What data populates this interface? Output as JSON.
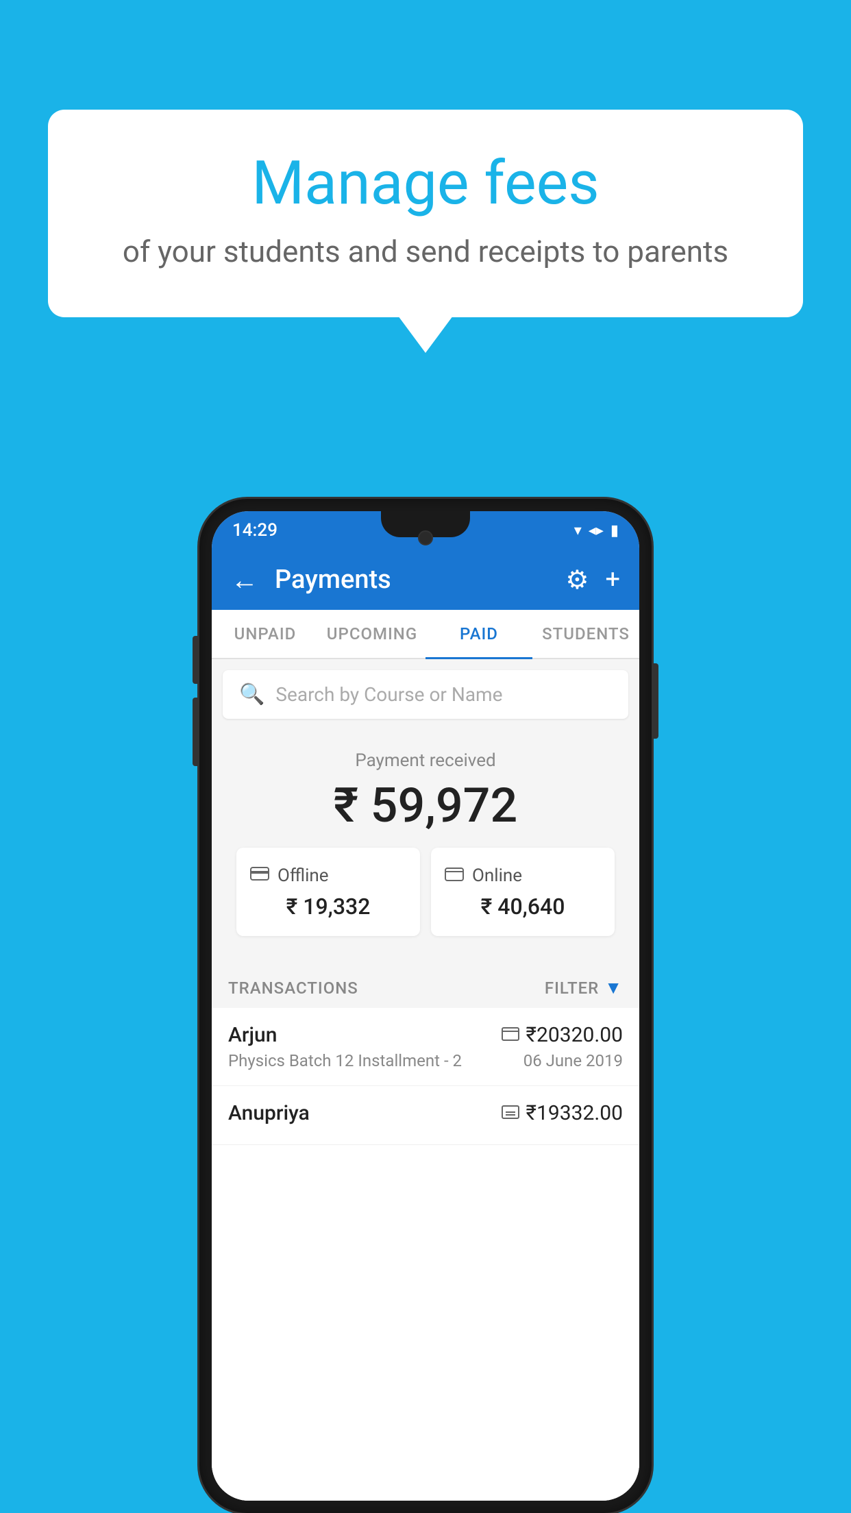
{
  "background_color": "#1ab3e8",
  "speech_bubble": {
    "title": "Manage fees",
    "subtitle": "of your students and send receipts to parents"
  },
  "status_bar": {
    "time": "14:29",
    "wifi": "▾",
    "signal": "▲",
    "battery": "▮"
  },
  "app_bar": {
    "title": "Payments",
    "back_icon": "←",
    "gear_icon": "⚙",
    "plus_icon": "+"
  },
  "tabs": [
    {
      "label": "UNPAID",
      "active": false
    },
    {
      "label": "UPCOMING",
      "active": false
    },
    {
      "label": "PAID",
      "active": true
    },
    {
      "label": "STUDENTS",
      "active": false
    }
  ],
  "search": {
    "placeholder": "Search by Course or Name"
  },
  "payment_summary": {
    "label": "Payment received",
    "amount": "₹ 59,972"
  },
  "payment_cards": [
    {
      "icon": "💳",
      "label": "Offline",
      "amount": "₹ 19,332"
    },
    {
      "icon": "💳",
      "label": "Online",
      "amount": "₹ 40,640"
    }
  ],
  "transactions_header": {
    "label": "TRANSACTIONS",
    "filter_label": "FILTER"
  },
  "transactions": [
    {
      "name": "Arjun",
      "icon": "💳",
      "amount": "₹20320.00",
      "course": "Physics Batch 12 Installment - 2",
      "date": "06 June 2019"
    },
    {
      "name": "Anupriya",
      "icon": "💵",
      "amount": "₹19332.00",
      "course": "",
      "date": ""
    }
  ]
}
